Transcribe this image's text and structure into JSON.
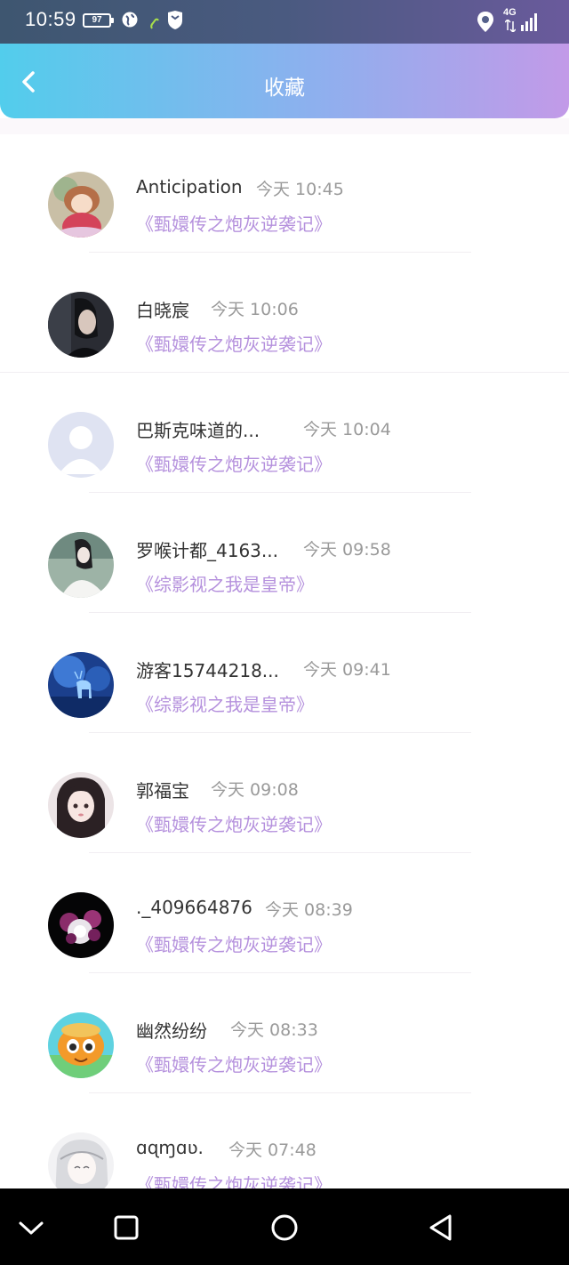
{
  "status_bar": {
    "time": "10:59",
    "battery": "97",
    "network": "4G"
  },
  "header": {
    "title": "收藏",
    "back_icon": "chevron-left-icon"
  },
  "favorites": [
    {
      "name": "Anticipation",
      "time": "今天 10:45",
      "book": "《甄嬛传之炮灰逆袭记》",
      "avatar": "girl-cartoon-avatar"
    },
    {
      "name": "白晓宸",
      "time": "今天 10:06",
      "book": "《甄嬛传之炮灰逆袭记》",
      "avatar": "dark-portrait-avatar"
    },
    {
      "name": "巴斯克味道的...",
      "time": "今天 10:04",
      "book": "《甄嬛传之炮灰逆袭记》",
      "avatar": "default-avatar"
    },
    {
      "name": "罗喉计都_4163...",
      "time": "今天 09:58",
      "book": "《综影视之我是皇帝》",
      "avatar": "white-robe-avatar"
    },
    {
      "name": "游客15744218...",
      "time": "今天 09:41",
      "book": "《综影视之我是皇帝》",
      "avatar": "blue-deer-avatar"
    },
    {
      "name": "郭福宝",
      "time": "今天 09:08",
      "book": "《甄嬛传之炮灰逆袭记》",
      "avatar": "girl-photo-avatar"
    },
    {
      "name": "._409664876",
      "time": "今天 08:39",
      "book": "《甄嬛传之炮灰逆袭记》",
      "avatar": "flower-avatar"
    },
    {
      "name": "幽然纷纷",
      "time": "今天 08:33",
      "book": "《甄嬛传之炮灰逆袭记》",
      "avatar": "cartoon-cat-avatar"
    },
    {
      "name": "ɑɋɱɑʋ.",
      "time": "今天 07:48",
      "book": "《甄嬛传之炮灰逆袭记》",
      "avatar": "anime-avatar"
    }
  ],
  "nav_bar": {
    "buttons": [
      "chevron-down-icon",
      "square-icon",
      "circle-icon",
      "triangle-back-icon"
    ]
  }
}
